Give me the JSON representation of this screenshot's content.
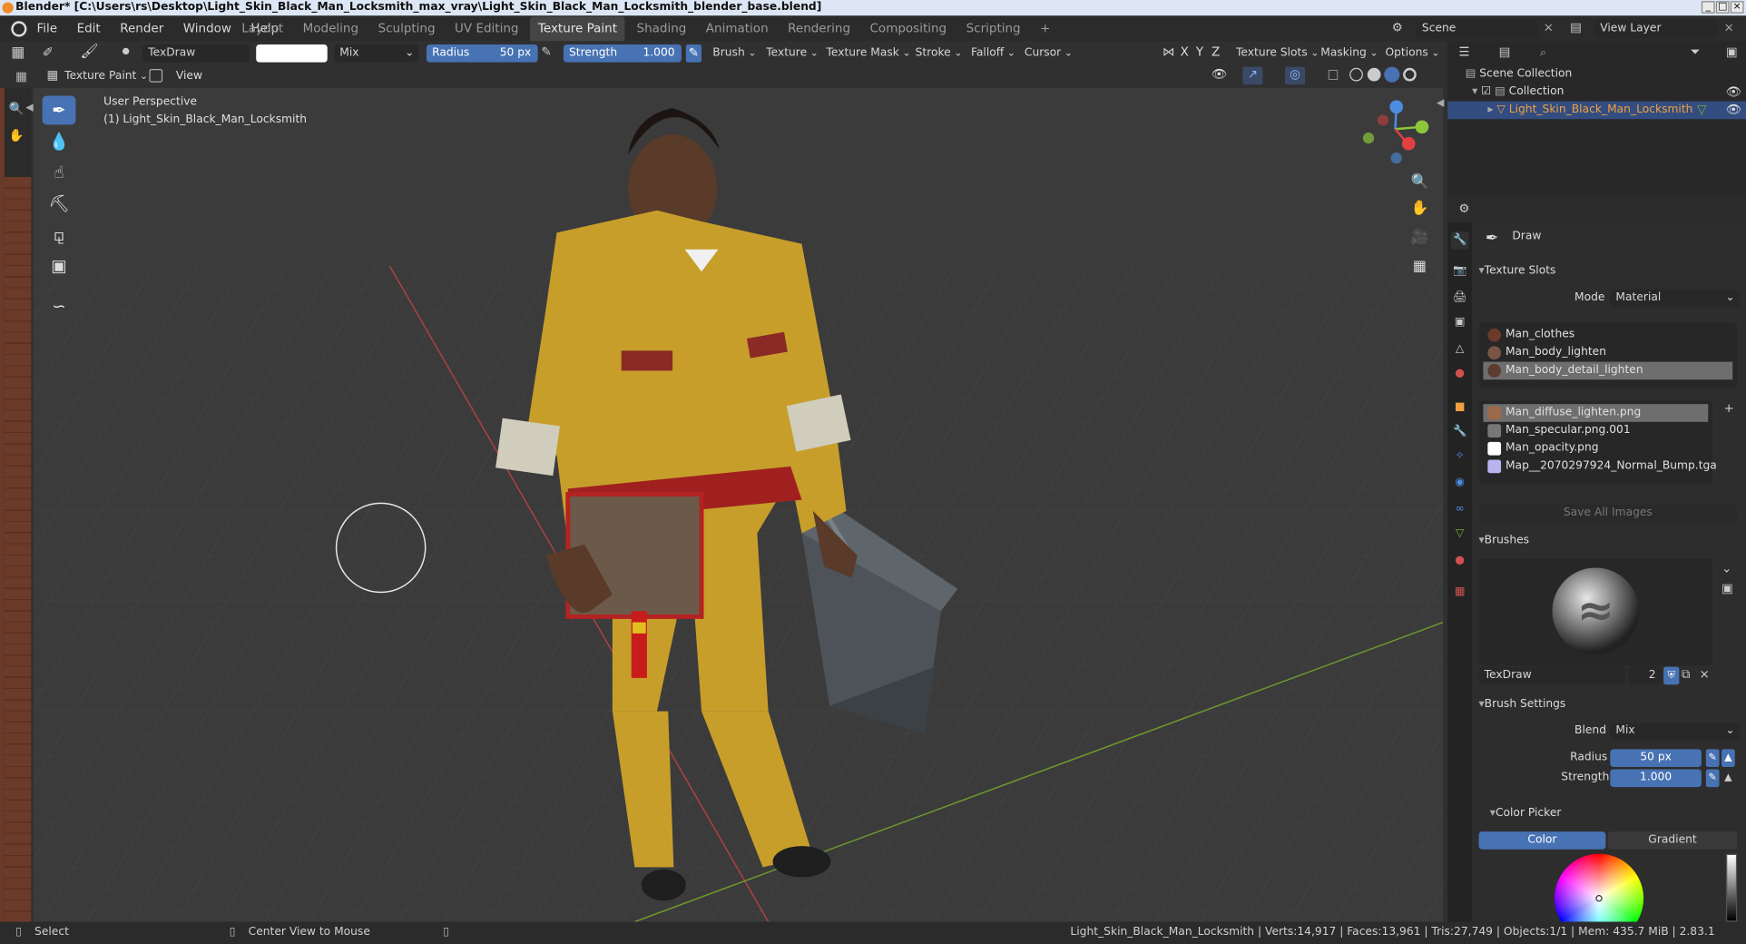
{
  "window": {
    "title": "Blender* [C:\\Users\\rs\\Desktop\\Light_Skin_Black_Man_Locksmith_max_vray\\Light_Skin_Black_Man_Locksmith_blender_base.blend]"
  },
  "menu": [
    "File",
    "Edit",
    "Render",
    "Window",
    "Help"
  ],
  "workspaces": [
    {
      "label": "Layout"
    },
    {
      "label": "Modeling"
    },
    {
      "label": "Sculpting"
    },
    {
      "label": "UV Editing"
    },
    {
      "label": "Texture Paint",
      "active": true
    },
    {
      "label": "Shading"
    },
    {
      "label": "Animation"
    },
    {
      "label": "Rendering"
    },
    {
      "label": "Compositing"
    },
    {
      "label": "Scripting"
    }
  ],
  "topright": {
    "scene": "Scene",
    "view_layer": "View Layer"
  },
  "tool_header": {
    "brush_name": "TexDraw",
    "blend": "Mix",
    "radius_label": "Radius",
    "radius_value": "50 px",
    "strength_label": "Strength",
    "strength_value": "1.000",
    "menus": [
      "Brush",
      "Texture",
      "Texture Mask",
      "Stroke",
      "Falloff",
      "Cursor"
    ],
    "axes": [
      "X",
      "Y",
      "Z"
    ],
    "right_menus": [
      "Texture Slots",
      "Masking",
      "Options"
    ]
  },
  "header2": {
    "mode": "Texture Paint",
    "view": "View"
  },
  "viewport": {
    "perspective": "User Perspective",
    "object_line": "(1) Light_Skin_Black_Man_Locksmith"
  },
  "outliner": {
    "root": "Scene Collection",
    "collection": "Collection",
    "object": "Light_Skin_Black_Man_Locksmith"
  },
  "properties": {
    "tool_name": "Draw",
    "texture_slots_title": "Texture Slots",
    "mode_label": "Mode",
    "mode_value": "Material",
    "materials": [
      {
        "name": "Man_clothes",
        "color": "#6b3a2a"
      },
      {
        "name": "Man_body_lighten",
        "color": "#7a5544"
      },
      {
        "name": "Man_body_detail_lighten",
        "color": "#5c3b30",
        "selected": true
      }
    ],
    "images": [
      {
        "name": "Man_diffuse_lighten.png",
        "color": "#9a6a4a",
        "selected": true
      },
      {
        "name": "Man_specular.png.001",
        "color": "#777777"
      },
      {
        "name": "Man_opacity.png",
        "color": "#ffffff"
      },
      {
        "name": "Map__2070297924_Normal_Bump.tga",
        "color": "#b9b3f0"
      }
    ],
    "save_all": "Save All Images",
    "brushes_title": "Brushes",
    "brush_name": "TexDraw",
    "brush_users": "2",
    "brush_settings_title": "Brush Settings",
    "blend_label": "Blend",
    "blend_value": "Mix",
    "radius_label": "Radius",
    "radius_value": "50 px",
    "strength_label": "Strength",
    "strength_value": "1.000",
    "color_picker_title": "Color Picker",
    "color_tab": "Color",
    "gradient_tab": "Gradient"
  },
  "status": {
    "select": "Select",
    "center": "Center View to Mouse",
    "info": "Light_Skin_Black_Man_Locksmith | Verts:14,917 | Faces:13,961 | Tris:27,749 | Objects:1/1 | Mem: 435.7 MiB | 2.83.1"
  },
  "colors": {
    "accent": "#4772b3",
    "active_object": "#f0a040",
    "x_axis": "#c84040",
    "y_axis": "#7ab030"
  }
}
